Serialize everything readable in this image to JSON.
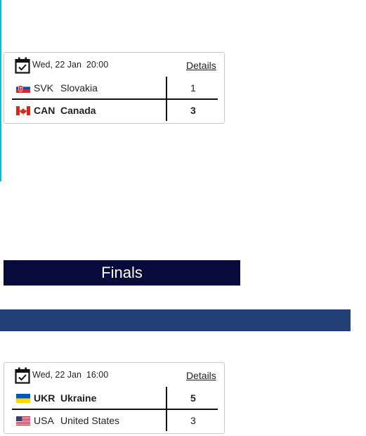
{
  "games": [
    {
      "date": "Wed, 22 Jan",
      "time": "20:00",
      "details_label": "Details",
      "teams": [
        {
          "code": "SVK",
          "name": "Slovakia",
          "score": "1",
          "flag": "svk-flag-icon",
          "winner": false
        },
        {
          "code": "CAN",
          "name": "Canada",
          "score": "3",
          "flag": "can-flag-icon",
          "winner": true
        }
      ]
    },
    {
      "date": "Wed, 22 Jan",
      "time": "16:00",
      "details_label": "Details",
      "teams": [
        {
          "code": "UKR",
          "name": "Ukraine",
          "score": "5",
          "flag": "ukr-flag-icon",
          "winner": true
        },
        {
          "code": "USA",
          "name": "United States",
          "score": "3",
          "flag": "usa-flag-icon",
          "winner": false
        }
      ]
    }
  ],
  "finals": {
    "title": "Finals"
  },
  "colors": {
    "finals_header_bg": "#070a3b",
    "round_bar_bg": "#233f77",
    "bracket_line": "#1ab8c4"
  }
}
